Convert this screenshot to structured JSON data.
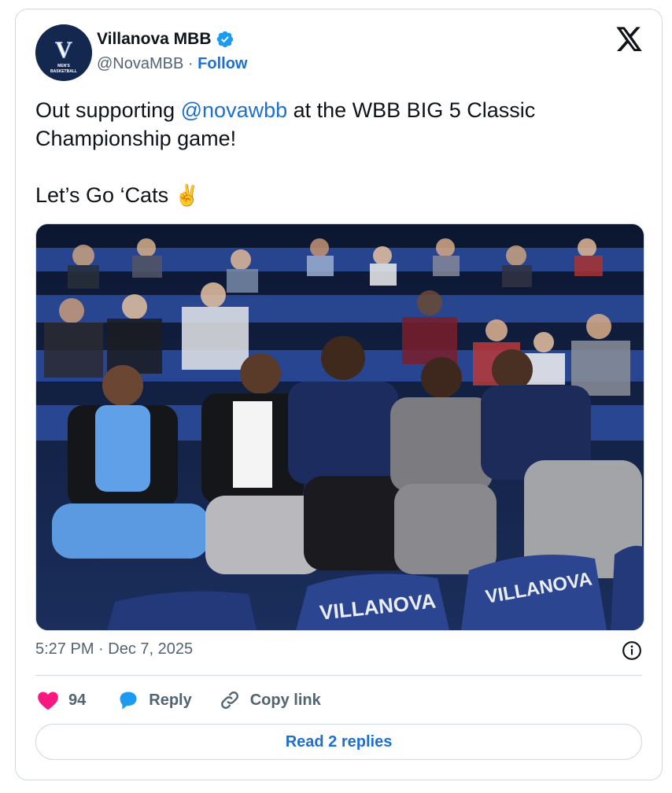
{
  "author": {
    "display_name": "Villanova MBB",
    "handle": "@NovaMBB",
    "separator": "·",
    "follow_label": "Follow",
    "avatar_logo_letter": "V",
    "avatar_logo_line1": "MEN'S",
    "avatar_logo_line2": "BASKETBALL",
    "verified_icon": "verified-badge-icon"
  },
  "tweet": {
    "text_before": "Out supporting ",
    "mention": "@novawbb",
    "text_after": " at the WBB BIG 5 Classic Championship game!",
    "line2": "Let’s Go ‘Cats ",
    "emoji": "✌️"
  },
  "photo": {
    "seat_text_left": "VILLANOVA",
    "seat_text_right": "VILLANOVA"
  },
  "meta": {
    "time": "5:27 PM",
    "separator": "·",
    "date": "Dec 7, 2025"
  },
  "actions": {
    "like_count": "94",
    "reply_label": "Reply",
    "copy_link_label": "Copy link"
  },
  "read_replies_label": "Read 2 replies",
  "colors": {
    "link": "#1d6fd1",
    "like": "#f91880",
    "reply_icon": "#1d9bf0",
    "secondary_text": "#536471",
    "border": "#cfd9de",
    "navy": "#13274f"
  }
}
